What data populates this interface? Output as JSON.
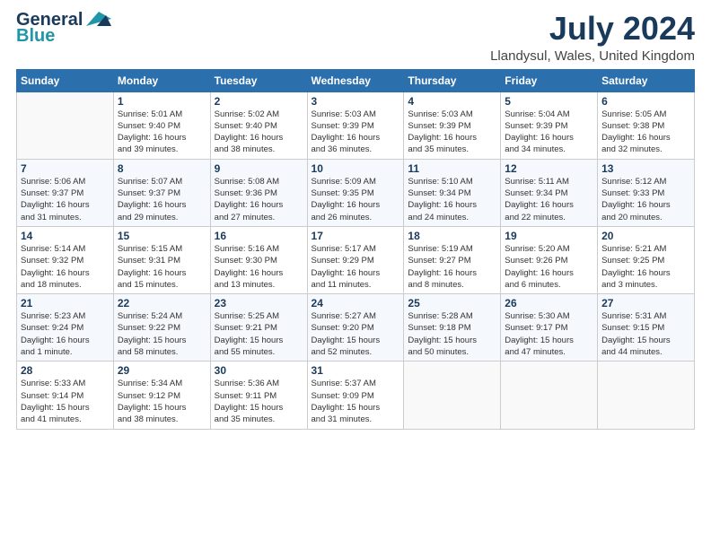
{
  "header": {
    "logo_general": "General",
    "logo_blue": "Blue",
    "main_title": "July 2024",
    "subtitle": "Llandysul, Wales, United Kingdom"
  },
  "calendar": {
    "days_of_week": [
      "Sunday",
      "Monday",
      "Tuesday",
      "Wednesday",
      "Thursday",
      "Friday",
      "Saturday"
    ],
    "weeks": [
      [
        {
          "day": "",
          "info": ""
        },
        {
          "day": "1",
          "info": "Sunrise: 5:01 AM\nSunset: 9:40 PM\nDaylight: 16 hours\nand 39 minutes."
        },
        {
          "day": "2",
          "info": "Sunrise: 5:02 AM\nSunset: 9:40 PM\nDaylight: 16 hours\nand 38 minutes."
        },
        {
          "day": "3",
          "info": "Sunrise: 5:03 AM\nSunset: 9:39 PM\nDaylight: 16 hours\nand 36 minutes."
        },
        {
          "day": "4",
          "info": "Sunrise: 5:03 AM\nSunset: 9:39 PM\nDaylight: 16 hours\nand 35 minutes."
        },
        {
          "day": "5",
          "info": "Sunrise: 5:04 AM\nSunset: 9:39 PM\nDaylight: 16 hours\nand 34 minutes."
        },
        {
          "day": "6",
          "info": "Sunrise: 5:05 AM\nSunset: 9:38 PM\nDaylight: 16 hours\nand 32 minutes."
        }
      ],
      [
        {
          "day": "7",
          "info": "Sunrise: 5:06 AM\nSunset: 9:37 PM\nDaylight: 16 hours\nand 31 minutes."
        },
        {
          "day": "8",
          "info": "Sunrise: 5:07 AM\nSunset: 9:37 PM\nDaylight: 16 hours\nand 29 minutes."
        },
        {
          "day": "9",
          "info": "Sunrise: 5:08 AM\nSunset: 9:36 PM\nDaylight: 16 hours\nand 27 minutes."
        },
        {
          "day": "10",
          "info": "Sunrise: 5:09 AM\nSunset: 9:35 PM\nDaylight: 16 hours\nand 26 minutes."
        },
        {
          "day": "11",
          "info": "Sunrise: 5:10 AM\nSunset: 9:34 PM\nDaylight: 16 hours\nand 24 minutes."
        },
        {
          "day": "12",
          "info": "Sunrise: 5:11 AM\nSunset: 9:34 PM\nDaylight: 16 hours\nand 22 minutes."
        },
        {
          "day": "13",
          "info": "Sunrise: 5:12 AM\nSunset: 9:33 PM\nDaylight: 16 hours\nand 20 minutes."
        }
      ],
      [
        {
          "day": "14",
          "info": "Sunrise: 5:14 AM\nSunset: 9:32 PM\nDaylight: 16 hours\nand 18 minutes."
        },
        {
          "day": "15",
          "info": "Sunrise: 5:15 AM\nSunset: 9:31 PM\nDaylight: 16 hours\nand 15 minutes."
        },
        {
          "day": "16",
          "info": "Sunrise: 5:16 AM\nSunset: 9:30 PM\nDaylight: 16 hours\nand 13 minutes."
        },
        {
          "day": "17",
          "info": "Sunrise: 5:17 AM\nSunset: 9:29 PM\nDaylight: 16 hours\nand 11 minutes."
        },
        {
          "day": "18",
          "info": "Sunrise: 5:19 AM\nSunset: 9:27 PM\nDaylight: 16 hours\nand 8 minutes."
        },
        {
          "day": "19",
          "info": "Sunrise: 5:20 AM\nSunset: 9:26 PM\nDaylight: 16 hours\nand 6 minutes."
        },
        {
          "day": "20",
          "info": "Sunrise: 5:21 AM\nSunset: 9:25 PM\nDaylight: 16 hours\nand 3 minutes."
        }
      ],
      [
        {
          "day": "21",
          "info": "Sunrise: 5:23 AM\nSunset: 9:24 PM\nDaylight: 16 hours\nand 1 minute."
        },
        {
          "day": "22",
          "info": "Sunrise: 5:24 AM\nSunset: 9:22 PM\nDaylight: 15 hours\nand 58 minutes."
        },
        {
          "day": "23",
          "info": "Sunrise: 5:25 AM\nSunset: 9:21 PM\nDaylight: 15 hours\nand 55 minutes."
        },
        {
          "day": "24",
          "info": "Sunrise: 5:27 AM\nSunset: 9:20 PM\nDaylight: 15 hours\nand 52 minutes."
        },
        {
          "day": "25",
          "info": "Sunrise: 5:28 AM\nSunset: 9:18 PM\nDaylight: 15 hours\nand 50 minutes."
        },
        {
          "day": "26",
          "info": "Sunrise: 5:30 AM\nSunset: 9:17 PM\nDaylight: 15 hours\nand 47 minutes."
        },
        {
          "day": "27",
          "info": "Sunrise: 5:31 AM\nSunset: 9:15 PM\nDaylight: 15 hours\nand 44 minutes."
        }
      ],
      [
        {
          "day": "28",
          "info": "Sunrise: 5:33 AM\nSunset: 9:14 PM\nDaylight: 15 hours\nand 41 minutes."
        },
        {
          "day": "29",
          "info": "Sunrise: 5:34 AM\nSunset: 9:12 PM\nDaylight: 15 hours\nand 38 minutes."
        },
        {
          "day": "30",
          "info": "Sunrise: 5:36 AM\nSunset: 9:11 PM\nDaylight: 15 hours\nand 35 minutes."
        },
        {
          "day": "31",
          "info": "Sunrise: 5:37 AM\nSunset: 9:09 PM\nDaylight: 15 hours\nand 31 minutes."
        },
        {
          "day": "",
          "info": ""
        },
        {
          "day": "",
          "info": ""
        },
        {
          "day": "",
          "info": ""
        }
      ]
    ]
  }
}
